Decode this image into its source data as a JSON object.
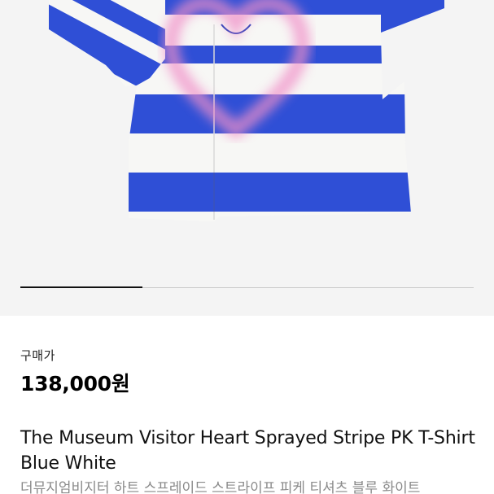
{
  "product": {
    "image_icon": "striped-tshirt-image",
    "colors": {
      "stripe_blue": "#2f4fd6",
      "stripe_white": "#f7f7f5",
      "spray_pink": "#f08fc8",
      "background": "#f4f4f4"
    },
    "gallery_progress": 0.27,
    "price_label": "구매가",
    "price": "138,000원",
    "title": "The Museum Visitor Heart Sprayed Stripe PK T-Shirt Blue White",
    "subtitle": "더뮤지엄비지터 하트 스프레이드 스트라이프 피케 티셔츠 블루 화이트"
  }
}
